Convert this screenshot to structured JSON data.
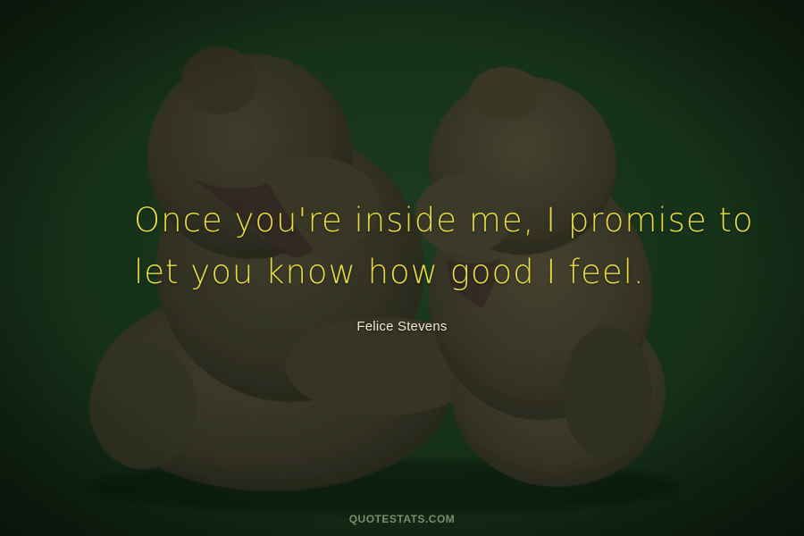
{
  "quote": {
    "line1": "Once you're inside me, I promise to",
    "line2": "let you know how good I feel."
  },
  "author": "Felice Stevens",
  "watermark": "QUOTESTATS.COM",
  "colors": {
    "background": "#1b3a1e",
    "quote_text": "#e7dc3f",
    "author_text": "#f0ead0",
    "watermark_text": "#7c8d66"
  }
}
